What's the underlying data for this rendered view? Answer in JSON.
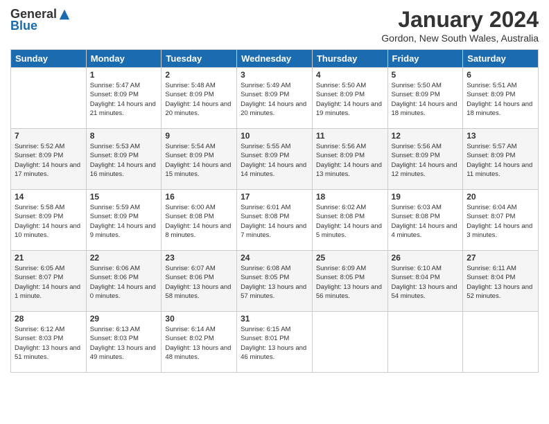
{
  "logo": {
    "general": "General",
    "blue": "Blue"
  },
  "title": "January 2024",
  "location": "Gordon, New South Wales, Australia",
  "days_of_week": [
    "Sunday",
    "Monday",
    "Tuesday",
    "Wednesday",
    "Thursday",
    "Friday",
    "Saturday"
  ],
  "weeks": [
    [
      {
        "day": "",
        "empty": true
      },
      {
        "day": "1",
        "sunrise": "Sunrise: 5:47 AM",
        "sunset": "Sunset: 8:09 PM",
        "daylight": "Daylight: 14 hours and 21 minutes."
      },
      {
        "day": "2",
        "sunrise": "Sunrise: 5:48 AM",
        "sunset": "Sunset: 8:09 PM",
        "daylight": "Daylight: 14 hours and 20 minutes."
      },
      {
        "day": "3",
        "sunrise": "Sunrise: 5:49 AM",
        "sunset": "Sunset: 8:09 PM",
        "daylight": "Daylight: 14 hours and 20 minutes."
      },
      {
        "day": "4",
        "sunrise": "Sunrise: 5:50 AM",
        "sunset": "Sunset: 8:09 PM",
        "daylight": "Daylight: 14 hours and 19 minutes."
      },
      {
        "day": "5",
        "sunrise": "Sunrise: 5:50 AM",
        "sunset": "Sunset: 8:09 PM",
        "daylight": "Daylight: 14 hours and 18 minutes."
      },
      {
        "day": "6",
        "sunrise": "Sunrise: 5:51 AM",
        "sunset": "Sunset: 8:09 PM",
        "daylight": "Daylight: 14 hours and 18 minutes."
      }
    ],
    [
      {
        "day": "7",
        "sunrise": "Sunrise: 5:52 AM",
        "sunset": "Sunset: 8:09 PM",
        "daylight": "Daylight: 14 hours and 17 minutes."
      },
      {
        "day": "8",
        "sunrise": "Sunrise: 5:53 AM",
        "sunset": "Sunset: 8:09 PM",
        "daylight": "Daylight: 14 hours and 16 minutes."
      },
      {
        "day": "9",
        "sunrise": "Sunrise: 5:54 AM",
        "sunset": "Sunset: 8:09 PM",
        "daylight": "Daylight: 14 hours and 15 minutes."
      },
      {
        "day": "10",
        "sunrise": "Sunrise: 5:55 AM",
        "sunset": "Sunset: 8:09 PM",
        "daylight": "Daylight: 14 hours and 14 minutes."
      },
      {
        "day": "11",
        "sunrise": "Sunrise: 5:56 AM",
        "sunset": "Sunset: 8:09 PM",
        "daylight": "Daylight: 14 hours and 13 minutes."
      },
      {
        "day": "12",
        "sunrise": "Sunrise: 5:56 AM",
        "sunset": "Sunset: 8:09 PM",
        "daylight": "Daylight: 14 hours and 12 minutes."
      },
      {
        "day": "13",
        "sunrise": "Sunrise: 5:57 AM",
        "sunset": "Sunset: 8:09 PM",
        "daylight": "Daylight: 14 hours and 11 minutes."
      }
    ],
    [
      {
        "day": "14",
        "sunrise": "Sunrise: 5:58 AM",
        "sunset": "Sunset: 8:09 PM",
        "daylight": "Daylight: 14 hours and 10 minutes."
      },
      {
        "day": "15",
        "sunrise": "Sunrise: 5:59 AM",
        "sunset": "Sunset: 8:09 PM",
        "daylight": "Daylight: 14 hours and 9 minutes."
      },
      {
        "day": "16",
        "sunrise": "Sunrise: 6:00 AM",
        "sunset": "Sunset: 8:08 PM",
        "daylight": "Daylight: 14 hours and 8 minutes."
      },
      {
        "day": "17",
        "sunrise": "Sunrise: 6:01 AM",
        "sunset": "Sunset: 8:08 PM",
        "daylight": "Daylight: 14 hours and 7 minutes."
      },
      {
        "day": "18",
        "sunrise": "Sunrise: 6:02 AM",
        "sunset": "Sunset: 8:08 PM",
        "daylight": "Daylight: 14 hours and 5 minutes."
      },
      {
        "day": "19",
        "sunrise": "Sunrise: 6:03 AM",
        "sunset": "Sunset: 8:08 PM",
        "daylight": "Daylight: 14 hours and 4 minutes."
      },
      {
        "day": "20",
        "sunrise": "Sunrise: 6:04 AM",
        "sunset": "Sunset: 8:07 PM",
        "daylight": "Daylight: 14 hours and 3 minutes."
      }
    ],
    [
      {
        "day": "21",
        "sunrise": "Sunrise: 6:05 AM",
        "sunset": "Sunset: 8:07 PM",
        "daylight": "Daylight: 14 hours and 1 minute."
      },
      {
        "day": "22",
        "sunrise": "Sunrise: 6:06 AM",
        "sunset": "Sunset: 8:06 PM",
        "daylight": "Daylight: 14 hours and 0 minutes."
      },
      {
        "day": "23",
        "sunrise": "Sunrise: 6:07 AM",
        "sunset": "Sunset: 8:06 PM",
        "daylight": "Daylight: 13 hours and 58 minutes."
      },
      {
        "day": "24",
        "sunrise": "Sunrise: 6:08 AM",
        "sunset": "Sunset: 8:05 PM",
        "daylight": "Daylight: 13 hours and 57 minutes."
      },
      {
        "day": "25",
        "sunrise": "Sunrise: 6:09 AM",
        "sunset": "Sunset: 8:05 PM",
        "daylight": "Daylight: 13 hours and 56 minutes."
      },
      {
        "day": "26",
        "sunrise": "Sunrise: 6:10 AM",
        "sunset": "Sunset: 8:04 PM",
        "daylight": "Daylight: 13 hours and 54 minutes."
      },
      {
        "day": "27",
        "sunrise": "Sunrise: 6:11 AM",
        "sunset": "Sunset: 8:04 PM",
        "daylight": "Daylight: 13 hours and 52 minutes."
      }
    ],
    [
      {
        "day": "28",
        "sunrise": "Sunrise: 6:12 AM",
        "sunset": "Sunset: 8:03 PM",
        "daylight": "Daylight: 13 hours and 51 minutes."
      },
      {
        "day": "29",
        "sunrise": "Sunrise: 6:13 AM",
        "sunset": "Sunset: 8:03 PM",
        "daylight": "Daylight: 13 hours and 49 minutes."
      },
      {
        "day": "30",
        "sunrise": "Sunrise: 6:14 AM",
        "sunset": "Sunset: 8:02 PM",
        "daylight": "Daylight: 13 hours and 48 minutes."
      },
      {
        "day": "31",
        "sunrise": "Sunrise: 6:15 AM",
        "sunset": "Sunset: 8:01 PM",
        "daylight": "Daylight: 13 hours and 46 minutes."
      },
      {
        "day": "",
        "empty": true
      },
      {
        "day": "",
        "empty": true
      },
      {
        "day": "",
        "empty": true
      }
    ]
  ]
}
